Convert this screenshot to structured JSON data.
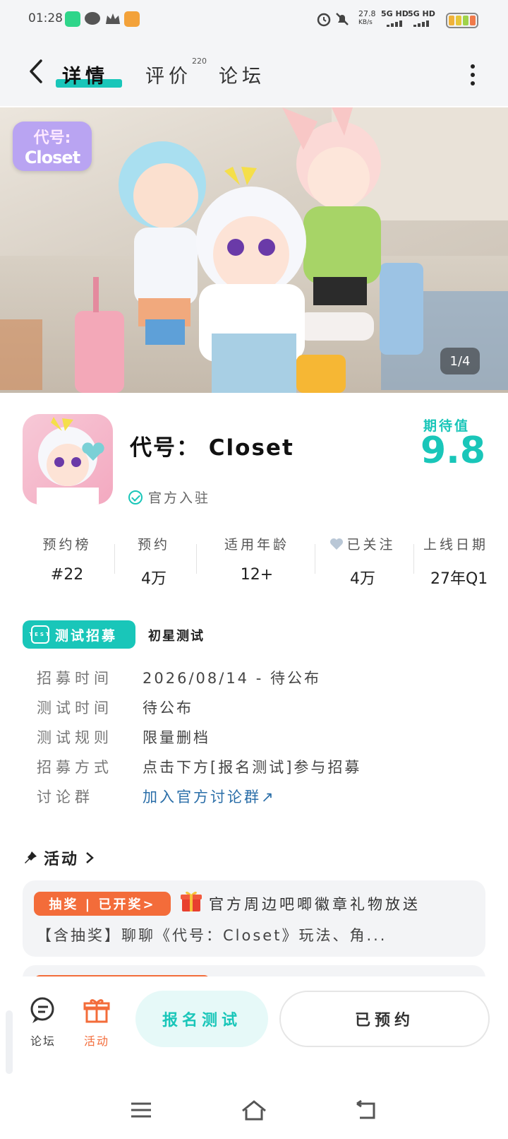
{
  "status_bar": {
    "time": "01:28",
    "net_speed_value": "27.8",
    "net_speed_unit": "KB/s",
    "signal1": "5G HD",
    "signal2": "5G HD"
  },
  "nav": {
    "tabs": [
      {
        "label": "详情"
      },
      {
        "label": "评价",
        "badge": "220"
      },
      {
        "label": "论坛"
      }
    ]
  },
  "hero": {
    "logo_line1": "代号:",
    "logo_line2": "Closet",
    "pager": "1/4"
  },
  "game": {
    "title": "代号： Closet",
    "verified_text": "官方入驻",
    "expectation_label": "期待值",
    "expectation_value": "9.8"
  },
  "stats": [
    {
      "label": "预约榜",
      "value": "#22"
    },
    {
      "label": "预约",
      "value": "4万"
    },
    {
      "label": "适用年龄",
      "value": "12+"
    },
    {
      "label": "已关注",
      "value": "4万"
    },
    {
      "label": "上线日期",
      "value": "27年Q1"
    }
  ],
  "test": {
    "badge_label": "测试招募",
    "badge_icon_text": "TEST",
    "type": "初星测试",
    "rows": [
      {
        "key": "招募时间",
        "value": "2026/08/14 - 待公布"
      },
      {
        "key": "测试时间",
        "value": "待公布"
      },
      {
        "key": "测试规则",
        "value": "限量删档"
      },
      {
        "key": "招募方式",
        "value": "点击下方[报名测试]参与招募"
      },
      {
        "key": "讨论群",
        "value": "加入官方讨论群↗"
      }
    ]
  },
  "activity": {
    "title": "活动",
    "card1": {
      "tag": "抽奖 | 已开奖>",
      "line1": "官方周边吧唧徽章礼物放送",
      "line2": "【含抽奖】聊聊《代号：Closet》玩法、角..."
    }
  },
  "bottom_bar": {
    "forum_label": "论坛",
    "activity_label": "活动",
    "join_button": "报名测试",
    "reserved_button": "已预约"
  },
  "colors": {
    "accent": "#19c6b9",
    "orange": "#f36c3a",
    "link": "#2a6ea8"
  }
}
